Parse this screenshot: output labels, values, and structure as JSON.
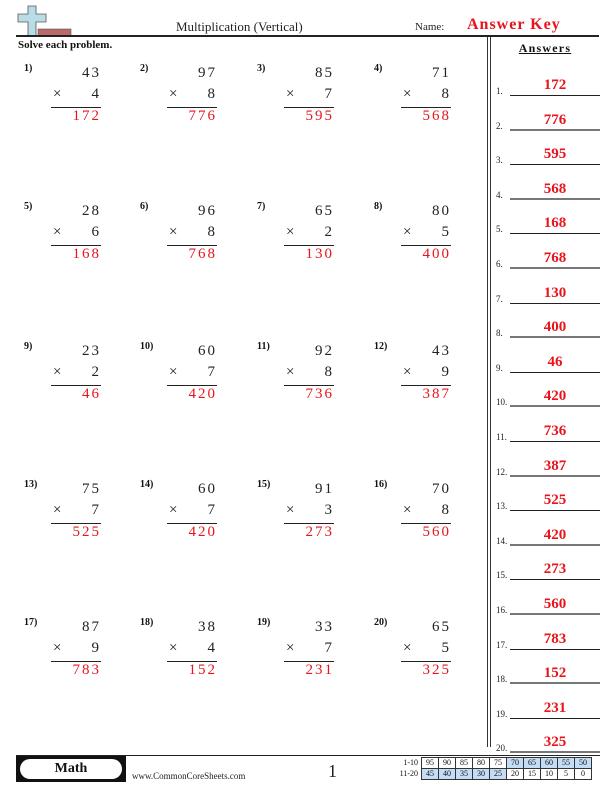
{
  "header": {
    "title": "Multiplication (Vertical)",
    "name_label": "Name:",
    "name_value": "Answer Key",
    "logo_icon": "plus-sign-with-eraser-icon",
    "instructions": "Solve each problem."
  },
  "colors": {
    "answer_red": "#e8141b",
    "score_highlight": "#c5dcf7"
  },
  "problems": [
    {
      "num": "1)",
      "top": "43",
      "op": "×",
      "mult": "4",
      "answer": "172"
    },
    {
      "num": "2)",
      "top": "97",
      "op": "×",
      "mult": "8",
      "answer": "776"
    },
    {
      "num": "3)",
      "top": "85",
      "op": "×",
      "mult": "7",
      "answer": "595"
    },
    {
      "num": "4)",
      "top": "71",
      "op": "×",
      "mult": "8",
      "answer": "568"
    },
    {
      "num": "5)",
      "top": "28",
      "op": "×",
      "mult": "6",
      "answer": "168"
    },
    {
      "num": "6)",
      "top": "96",
      "op": "×",
      "mult": "8",
      "answer": "768"
    },
    {
      "num": "7)",
      "top": "65",
      "op": "×",
      "mult": "2",
      "answer": "130"
    },
    {
      "num": "8)",
      "top": "80",
      "op": "×",
      "mult": "5",
      "answer": "400"
    },
    {
      "num": "9)",
      "top": "23",
      "op": "×",
      "mult": "2",
      "answer": "46"
    },
    {
      "num": "10)",
      "top": "60",
      "op": "×",
      "mult": "7",
      "answer": "420"
    },
    {
      "num": "11)",
      "top": "92",
      "op": "×",
      "mult": "8",
      "answer": "736"
    },
    {
      "num": "12)",
      "top": "43",
      "op": "×",
      "mult": "9",
      "answer": "387"
    },
    {
      "num": "13)",
      "top": "75",
      "op": "×",
      "mult": "7",
      "answer": "525"
    },
    {
      "num": "14)",
      "top": "60",
      "op": "×",
      "mult": "7",
      "answer": "420"
    },
    {
      "num": "15)",
      "top": "91",
      "op": "×",
      "mult": "3",
      "answer": "273"
    },
    {
      "num": "16)",
      "top": "70",
      "op": "×",
      "mult": "8",
      "answer": "560"
    },
    {
      "num": "17)",
      "top": "87",
      "op": "×",
      "mult": "9",
      "answer": "783"
    },
    {
      "num": "18)",
      "top": "38",
      "op": "×",
      "mult": "4",
      "answer": "152"
    },
    {
      "num": "19)",
      "top": "33",
      "op": "×",
      "mult": "7",
      "answer": "231"
    },
    {
      "num": "20)",
      "top": "65",
      "op": "×",
      "mult": "5",
      "answer": "325"
    }
  ],
  "answers_panel": {
    "title": "Answers",
    "items": [
      {
        "num": "1.",
        "value": "172"
      },
      {
        "num": "2.",
        "value": "776"
      },
      {
        "num": "3.",
        "value": "595"
      },
      {
        "num": "4.",
        "value": "568"
      },
      {
        "num": "5.",
        "value": "168"
      },
      {
        "num": "6.",
        "value": "768"
      },
      {
        "num": "7.",
        "value": "130"
      },
      {
        "num": "8.",
        "value": "400"
      },
      {
        "num": "9.",
        "value": "46"
      },
      {
        "num": "10.",
        "value": "420"
      },
      {
        "num": "11.",
        "value": "736"
      },
      {
        "num": "12.",
        "value": "387"
      },
      {
        "num": "13.",
        "value": "525"
      },
      {
        "num": "14.",
        "value": "420"
      },
      {
        "num": "15.",
        "value": "273"
      },
      {
        "num": "16.",
        "value": "560"
      },
      {
        "num": "17.",
        "value": "783"
      },
      {
        "num": "18.",
        "value": "152"
      },
      {
        "num": "19.",
        "value": "231"
      },
      {
        "num": "20.",
        "value": "325"
      }
    ]
  },
  "footer": {
    "subject": "Math",
    "site": "www.CommonCoreSheets.com",
    "page": "1",
    "score_rows": [
      {
        "label": "1-10",
        "values": [
          "95",
          "90",
          "85",
          "80",
          "75",
          "70",
          "65",
          "60",
          "55",
          "50"
        ],
        "highlight": [
          false,
          false,
          false,
          false,
          false,
          true,
          true,
          true,
          true,
          true
        ]
      },
      {
        "label": "11-20",
        "values": [
          "45",
          "40",
          "35",
          "30",
          "25",
          "20",
          "15",
          "10",
          "5",
          "0"
        ],
        "highlight": [
          true,
          true,
          true,
          true,
          true,
          false,
          false,
          false,
          false,
          false
        ]
      }
    ]
  }
}
